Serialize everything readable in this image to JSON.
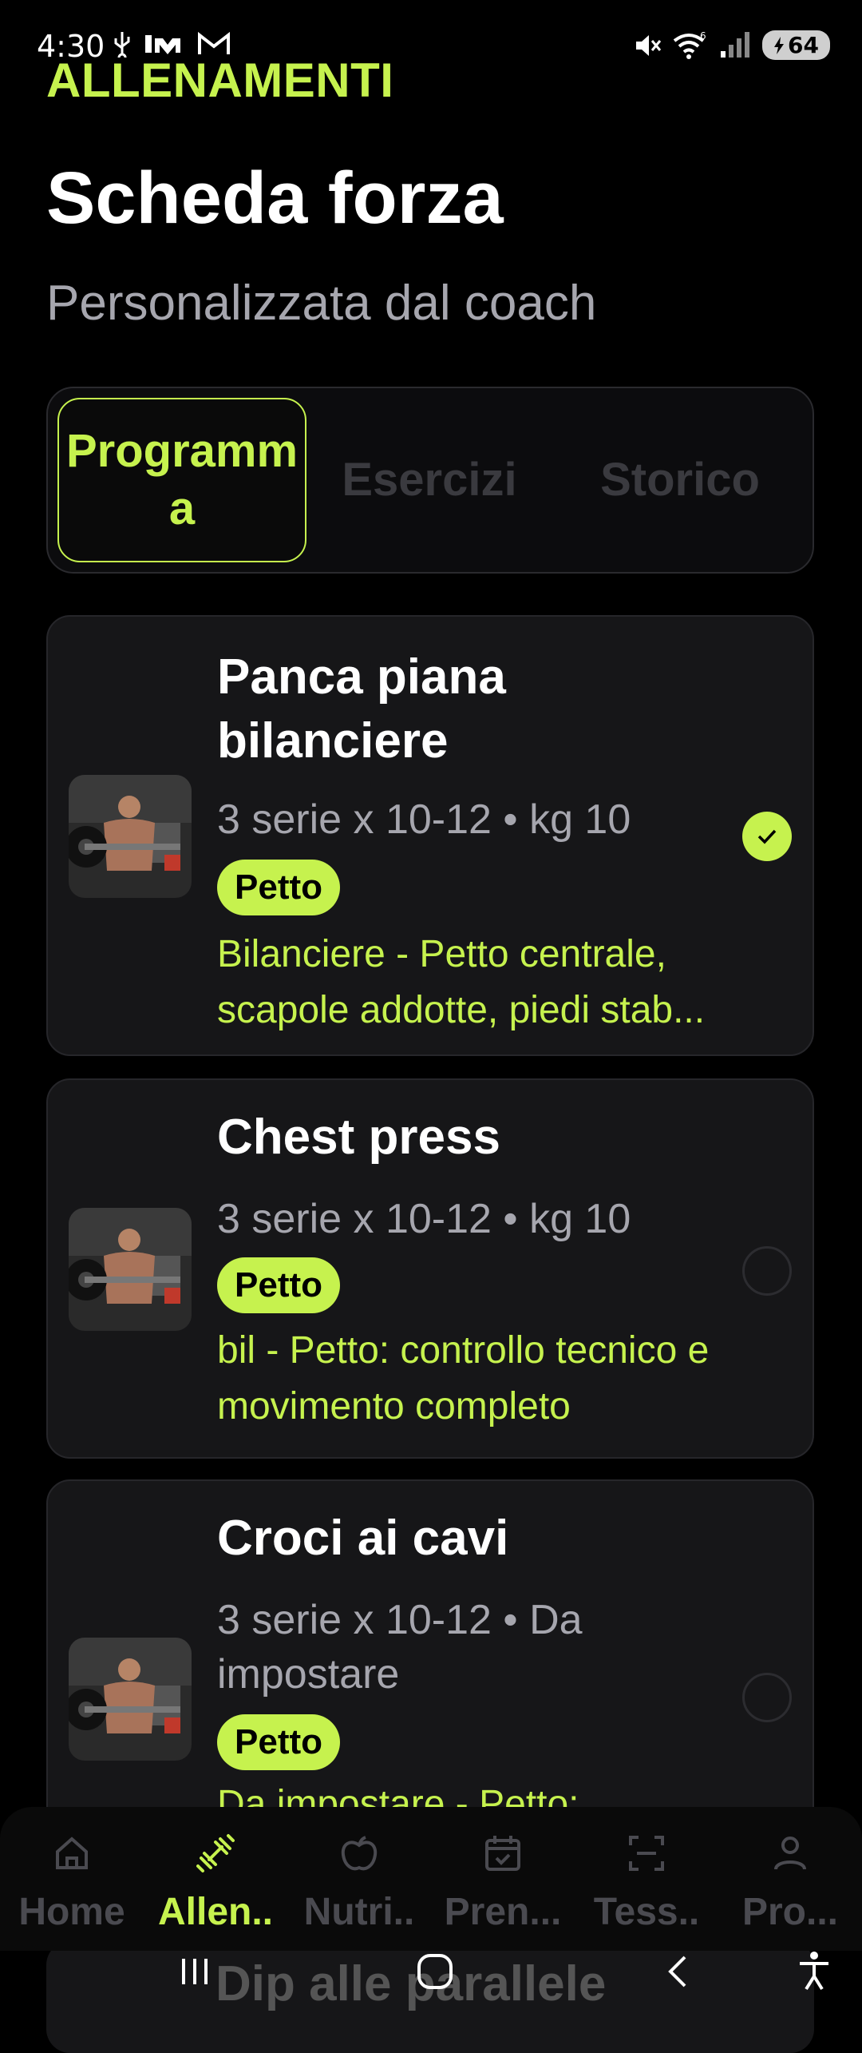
{
  "status_bar": {
    "time": "4:30",
    "battery": "64"
  },
  "header": {
    "section_label": "ALLENAMENTI",
    "title": "Scheda forza",
    "subtitle": "Personalizzata dal coach"
  },
  "tabs": [
    {
      "label": "Programma",
      "active": true
    },
    {
      "label": "Esercizi",
      "active": false
    },
    {
      "label": "Storico",
      "active": false
    }
  ],
  "exercises": [
    {
      "title": "Panca piana bilanciere",
      "meta": "3 serie x 10-12 • kg 10",
      "badge": "Petto",
      "note": "Bilanciere - Petto centrale, scapole addotte, piedi stab...",
      "completed": true
    },
    {
      "title": "Chest press",
      "meta": "3 serie x 10-12 • kg 10",
      "badge": "Petto",
      "note": "bil - Petto: controllo tecnico e movimento completo",
      "completed": false
    },
    {
      "title": "Croci ai cavi",
      "meta": "3 serie x 10-12 • Da impostare",
      "badge": "Petto",
      "note": "Da impostare - Petto:",
      "completed": false
    },
    {
      "title": "Dip alle parallele"
    }
  ],
  "bottom_nav": [
    {
      "label": "Home",
      "icon": "home-icon"
    },
    {
      "label": "Allen..",
      "icon": "dumbbell-icon",
      "active": true
    },
    {
      "label": "Nutri..",
      "icon": "apple-icon"
    },
    {
      "label": "Pren...",
      "icon": "calendar-check-icon"
    },
    {
      "label": "Tess..",
      "icon": "scan-icon"
    },
    {
      "label": "Pro...",
      "icon": "profile-icon"
    }
  ],
  "colors": {
    "accent": "#c6f24e",
    "background": "#000000",
    "card": "#161618",
    "muted_text": "#a6a6ae"
  }
}
